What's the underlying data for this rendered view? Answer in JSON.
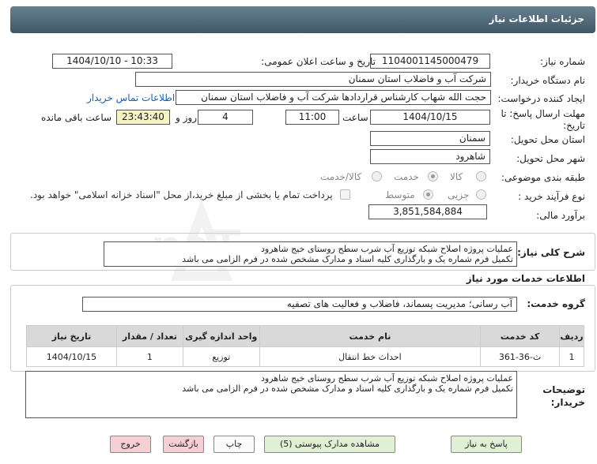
{
  "header": {
    "title": "جزئیات اطلاعات نیاز"
  },
  "form": {
    "need_number_label": "شماره نیاز:",
    "need_number": "1104001145000479",
    "announce_label": "تاریخ و ساعت اعلان عمومی:",
    "announce_value": "1404/10/10 - 10:33",
    "buyer_org_label": "نام دستگاه خریدار:",
    "buyer_org": "شرکت آب و فاضلاب استان سمنان",
    "requester_label": "ایجاد کننده درخواست:",
    "requester": "حجت الله شهاب کارشناس قراردادها شرکت آب و فاضلاب استان سمنان",
    "contact_link": "اطلاعات تماس خریدار",
    "deadline_label": "مهلت ارسال پاسخ: تا تاریخ:",
    "deadline_date": "1404/10/15",
    "hour_label": "ساعت",
    "deadline_time": "11:00",
    "days_value": "4",
    "days_label": "روز و",
    "remaining_value": "23:43:40",
    "remaining_label": "ساعت باقی مانده",
    "province_label": "استان محل تحویل:",
    "province": "سمنان",
    "city_label": "شهر محل تحویل:",
    "city": "شاهرود",
    "category_label": "طبقه بندی موضوعی:",
    "category_options": [
      "کالا",
      "خدمت",
      "کالا/خدمت"
    ],
    "category_selected": "خدمت",
    "process_label": "نوع فرآیند خرید :",
    "process_options": [
      "جزیی",
      "متوسط"
    ],
    "process_selected": "متوسط",
    "payment_note": "پرداخت تمام یا بخشی از مبلغ خرید،از محل \"اسناد خزانه اسلامی\" خواهد بود.",
    "budget_label": "برآورد مالی:",
    "budget": "3,851,584,884"
  },
  "summary": {
    "label": "شرح کلی نیاز:",
    "text": "عملیات پروژه اصلاح شبکه توزیع آب شرب سطح روستای خیج شاهرود\nتکمیل فرم شماره یک و بارگذاری کلیه اسناد و مدارک مشخص شده در فرم الزامی می باشد"
  },
  "services": {
    "title": "اطلاعات خدمات مورد نیاز",
    "group_label": "گروه خدمت:",
    "group_value": "آب رسانی؛ مدیریت پسماند، فاضلاب و فعالیت های تصفیه",
    "columns": [
      "ردیف",
      "کد خدمت",
      "نام خدمت",
      "واحد اندازه گیری",
      "تعداد / مقدار",
      "تاریخ نیاز"
    ],
    "rows": [
      [
        "1",
        "ث-36-361",
        "احداث خط انتقال",
        "توزیع",
        "1",
        "1404/10/15"
      ]
    ]
  },
  "buyer_notes": {
    "label": "توضیحات خریدار:",
    "text": "عملیات پروژه اصلاح شبکه توزیع آب شرب سطح روستای خیج شاهرود\nتکمیل فرم شماره یک و بارگذاری کلیه اسناد و مدارک مشخص شده در فرم الزامی می باشد"
  },
  "buttons": {
    "reply": "پاسخ به نیاز",
    "view_docs": "مشاهده مدارک پیوستی (5)",
    "print": "چاپ",
    "back": "بازگشت",
    "exit": "خروج"
  },
  "watermark": {
    "text": "AriaTender.neT"
  },
  "colors": {
    "header": "#4f6877",
    "link": "#1a5fb4",
    "green_btn": "#dff0d4",
    "pink_btn": "#f6cfd2",
    "remaining_bg": "#f5f3c4"
  }
}
